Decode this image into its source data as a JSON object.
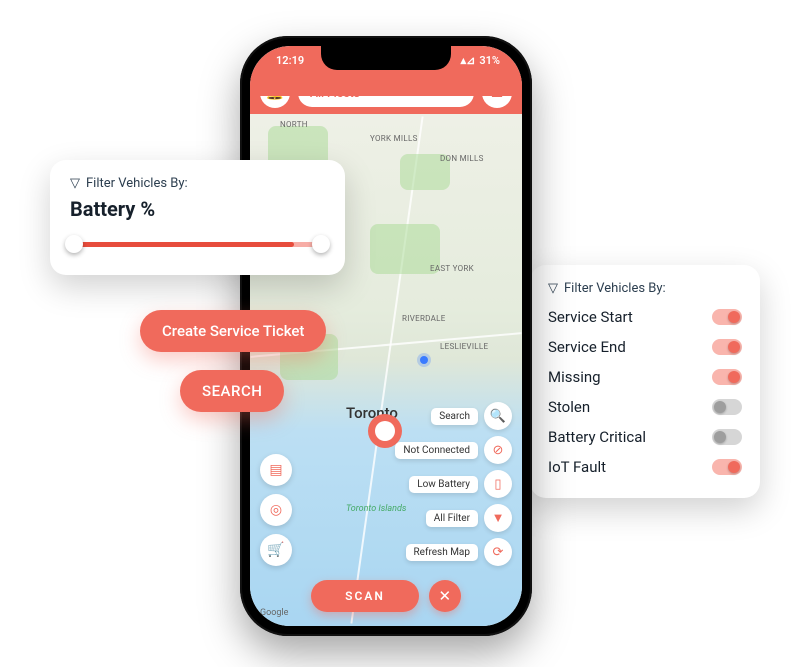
{
  "statusbar": {
    "time": "12:19",
    "battery": "31%"
  },
  "topbar": {
    "fleet_label": "All Fleets"
  },
  "map": {
    "city": "Toronto",
    "islands": "Toronto Islands",
    "attribution": "Google",
    "areas": {
      "north": "NORTH",
      "york_mills": "YORK MILLS",
      "don_mills": "DON MILLS",
      "east_york": "EAST YORK",
      "riverdale": "RIVERDALE",
      "leslieville": "LESLIEVILLE"
    }
  },
  "chips": {
    "search": "Search",
    "not_connected": "Not Connected",
    "low_battery": "Low Battery",
    "all_filter": "All Filter",
    "refresh_map": "Refresh Map"
  },
  "scan": "SCAN",
  "battery_panel": {
    "heading": "Filter Vehicles By:",
    "title": "Battery %"
  },
  "pills": {
    "create": "Create Service Ticket",
    "search": "SEARCH"
  },
  "toggle_panel": {
    "heading": "Filter Vehicles By:",
    "items": [
      {
        "label": "Service Start",
        "on": true
      },
      {
        "label": "Service End",
        "on": true
      },
      {
        "label": "Missing",
        "on": true
      },
      {
        "label": "Stolen",
        "on": false
      },
      {
        "label": "Battery Critical",
        "on": false
      },
      {
        "label": "IoT Fault",
        "on": true
      }
    ]
  }
}
